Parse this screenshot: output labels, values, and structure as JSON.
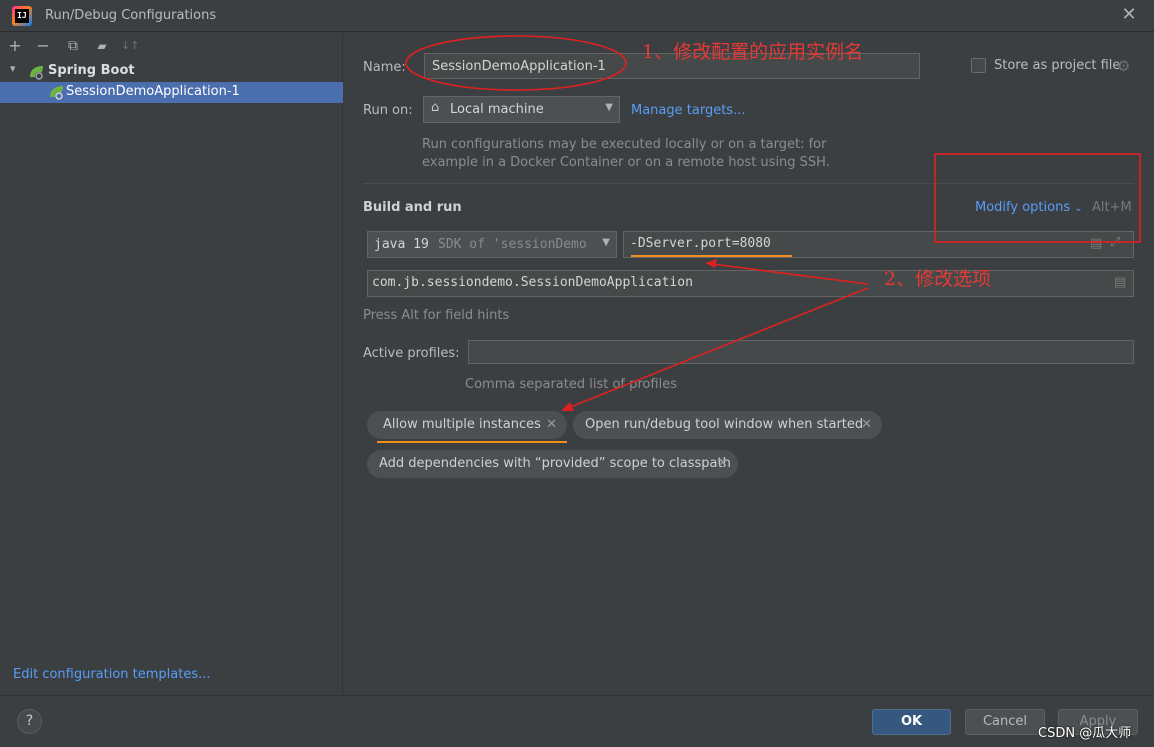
{
  "window": {
    "title": "Run/Debug Configurations",
    "logo_text": "IJ"
  },
  "left": {
    "toolbar": {
      "add": "+",
      "remove": "−",
      "copy": "⧉",
      "folder": "▰",
      "sort": "↓↑"
    },
    "tree": {
      "group_label": "Spring Boot",
      "item_label": "SessionDemoApplication-1"
    },
    "edit_templates": "Edit configuration templates..."
  },
  "form": {
    "name_label": "Name:",
    "name_value": "SessionDemoApplication-1",
    "store_label": "Store as project file",
    "run_on_label": "Run on:",
    "run_on_value": "Local machine",
    "manage_targets": "Manage targets...",
    "run_hint_1": "Run configurations may be executed locally or on a target: for",
    "run_hint_2": "example in a Docker Container or on a remote host using SSH.",
    "build_run_label": "Build and run",
    "modify_options": "Modify options",
    "modify_shortcut": "Alt+M",
    "jdk_main": "java 19",
    "jdk_sub": "SDK of 'sessionDemo",
    "vm_options": "-DServer.port=8080",
    "main_class": "com.jb.sessiondemo.SessionDemoApplication",
    "field_hint": "Press Alt for field hints",
    "profiles_label": "Active profiles:",
    "profiles_value": "",
    "profiles_hint": "Comma separated list of profiles"
  },
  "chips": [
    {
      "label": "Allow multiple instances"
    },
    {
      "label": "Open run/debug tool window when started"
    },
    {
      "label": "Add dependencies with “provided” scope to classpath"
    }
  ],
  "buttons": {
    "help": "?",
    "ok": "OK",
    "cancel": "Cancel",
    "apply": "Apply"
  },
  "annotations": {
    "note1": "1、修改配置的应用实例名",
    "note2": "2、修改选项",
    "color": "#e02020"
  },
  "watermark": "CSDN @瓜大师",
  "colors": {
    "background": "#3c3f41",
    "selection": "#4b6eaf",
    "link": "#589df6",
    "ok_button": "#365880",
    "underline": "#f0901a"
  }
}
